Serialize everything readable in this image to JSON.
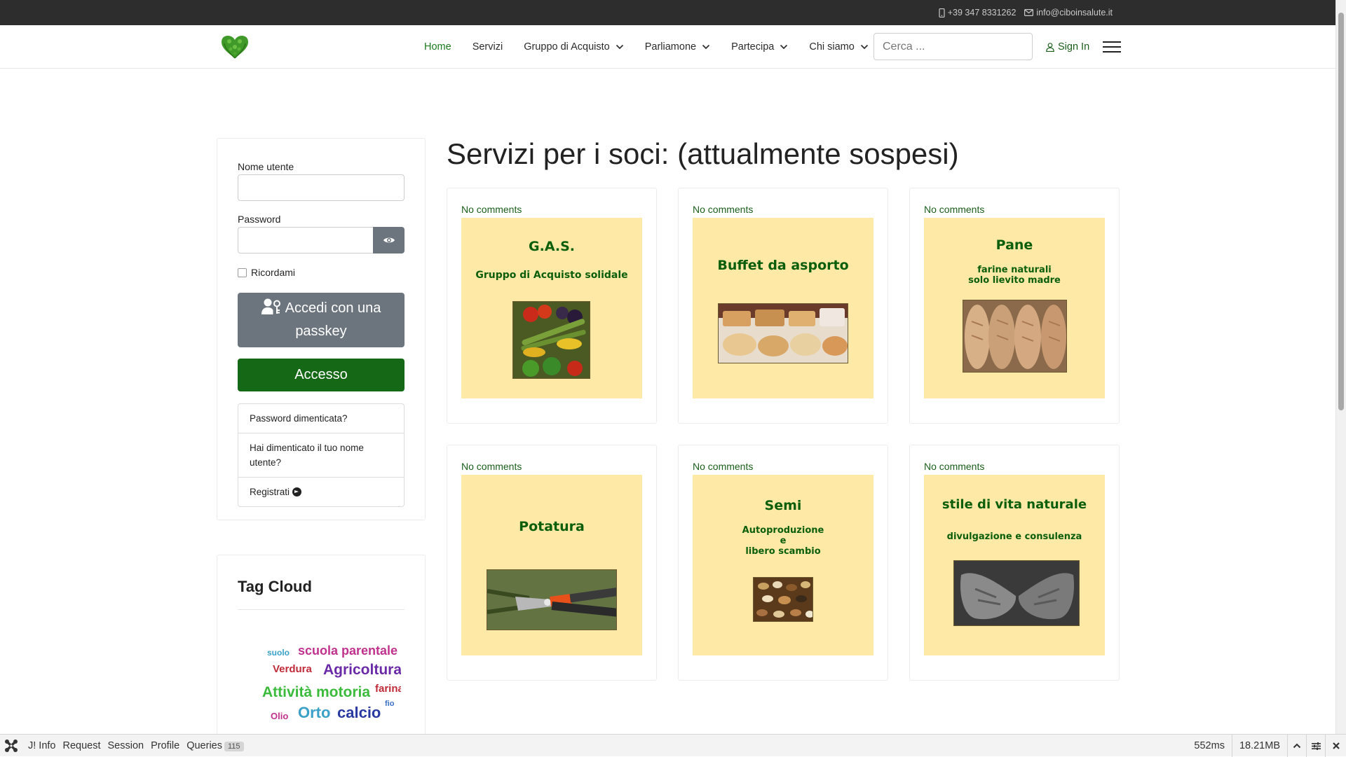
{
  "topbar": {
    "phone": "+39 347 8331262",
    "email": "info@ciboinsalute.it"
  },
  "nav": {
    "items": [
      {
        "label": "Home",
        "active": true,
        "dropdown": false
      },
      {
        "label": "Servizi",
        "active": false,
        "dropdown": false
      },
      {
        "label": "Gruppo di Acquisto",
        "active": false,
        "dropdown": true
      },
      {
        "label": "Parliamone",
        "active": false,
        "dropdown": true
      },
      {
        "label": "Partecipa",
        "active": false,
        "dropdown": true
      },
      {
        "label": "Chi siamo",
        "active": false,
        "dropdown": true
      }
    ],
    "search_placeholder": "Cerca ...",
    "signin_label": "Sign In"
  },
  "login": {
    "username_label": "Nome utente",
    "username_value": "",
    "password_label": "Password",
    "password_value": "",
    "remember_label": "Ricordami",
    "passkey_label": "Accedi con una passkey",
    "submit_label": "Accesso",
    "links": [
      {
        "label": "Password dimenticata?"
      },
      {
        "label": "Hai dimenticato il tuo nome utente?"
      },
      {
        "label": "Registrati"
      }
    ]
  },
  "tagcloud": {
    "title": "Tag Cloud",
    "tags": [
      {
        "label": "suolo",
        "color": "#3aa0c8"
      },
      {
        "label": "scuola parentale",
        "color": "#c0328e"
      },
      {
        "label": "Verdura",
        "color": "#c02b3a"
      },
      {
        "label": "Agricoltura",
        "color": "#6a2aa8"
      },
      {
        "label": "Attività motoria",
        "color": "#3bbb3b"
      },
      {
        "label": "farina",
        "color": "#c02b3a"
      },
      {
        "label": "fio",
        "color": "#3a6fc8"
      },
      {
        "label": "Olio",
        "color": "#c0328e"
      },
      {
        "label": "Orto",
        "color": "#3aa0c8"
      },
      {
        "label": "calcio",
        "color": "#2a3aa0"
      }
    ]
  },
  "main": {
    "title": "Servizi per i soci: (attualmente sospesi)",
    "cards": [
      {
        "comments": "No comments",
        "title": "G.A.S.",
        "subtitle": "Gruppo di Acquisto solidale"
      },
      {
        "comments": "No comments",
        "title": "Buffet da asporto",
        "subtitle": ""
      },
      {
        "comments": "No comments",
        "title": "Pane",
        "subtitle": "farine naturali\nsolo lievito madre"
      },
      {
        "comments": "No comments",
        "title": "Potatura",
        "subtitle": ""
      },
      {
        "comments": "No comments",
        "title": "Semi",
        "subtitle": "Autoproduzione\ne\nlibero scambio"
      },
      {
        "comments": "No comments",
        "title": "stile di vita naturale",
        "subtitle": "divulgazione e consulenza"
      }
    ]
  },
  "debugbar": {
    "tabs": [
      {
        "label": "J! Info"
      },
      {
        "label": "Request"
      },
      {
        "label": "Session"
      },
      {
        "label": "Profile"
      },
      {
        "label": "Queries",
        "badge": "115"
      }
    ],
    "time": "552ms",
    "memory": "18.21MB"
  },
  "colors": {
    "accent_green": "#156815",
    "link_green": "#1a5e1a",
    "card_bg": "#ffe9a6",
    "topbar_bg": "#2d2d2d"
  }
}
